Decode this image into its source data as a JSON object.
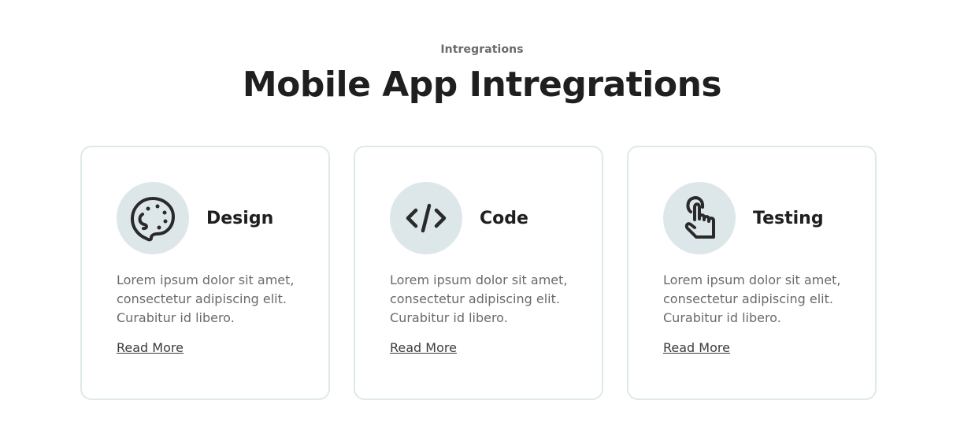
{
  "section": {
    "eyebrow": "Intregrations",
    "title": "Mobile App Intregrations"
  },
  "cards": [
    {
      "icon": "palette-icon",
      "title": "Design",
      "description": "Lorem ipsum dolor sit amet, consectetur adipiscing elit. Curabitur id libero.",
      "link": "Read More"
    },
    {
      "icon": "code-icon",
      "title": "Code",
      "description": "Lorem ipsum dolor sit amet, consectetur adipiscing elit. Curabitur id libero.",
      "link": "Read More"
    },
    {
      "icon": "tap-hand-icon",
      "title": "Testing",
      "description": "Lorem ipsum dolor sit amet, consectetur adipiscing elit. Curabitur id libero.",
      "link": "Read More"
    }
  ],
  "colors": {
    "card_border": "#dfe9e8",
    "icon_background": "#dde7ea",
    "heading": "#1f1f1f",
    "body_text": "#6a6a6a"
  }
}
